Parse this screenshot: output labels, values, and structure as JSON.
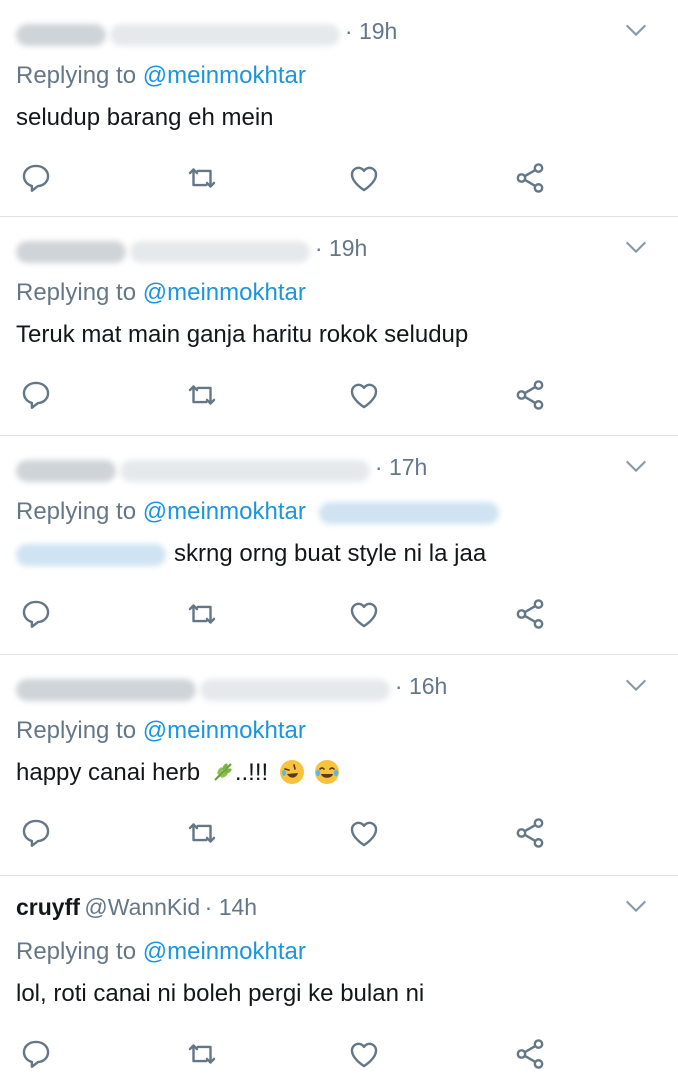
{
  "tweets": [
    {
      "name": "",
      "handle": "",
      "time": "· 19h",
      "replying_label": "Replying to",
      "replying_to": "@meinmokhtar",
      "text": "seludup barang eh mein"
    },
    {
      "name": "",
      "handle": "",
      "time": "· 19h",
      "replying_label": "Replying to",
      "replying_to": "@meinmokhtar",
      "text": "Teruk mat main ganja haritu rokok seludup"
    },
    {
      "name": "",
      "handle": "",
      "time": "· 17h",
      "replying_label": "Replying to",
      "replying_to": "@meinmokhtar",
      "text": "skrng orng buat style ni la jaa"
    },
    {
      "name": "",
      "handle": "",
      "time": "· 16h",
      "replying_label": "Replying to",
      "replying_to": "@meinmokhtar",
      "text": "happy canai herb",
      "text_suffix": "..!!!"
    },
    {
      "name": "cruyff",
      "handle": "@WannKid",
      "time": "· 14h",
      "replying_label": "Replying to",
      "replying_to": "@meinmokhtar",
      "text": "lol, roti canai ni boleh pergi ke bulan ni"
    }
  ],
  "icons": {
    "reply": "reply-icon",
    "retweet": "retweet-icon",
    "like": "heart-icon",
    "share": "share-icon",
    "menu": "chevron-down-icon"
  },
  "colors": {
    "link": "#1b95e0",
    "secondary_text": "#657786",
    "icon": "#657786",
    "divider": "#dfe3e6"
  }
}
